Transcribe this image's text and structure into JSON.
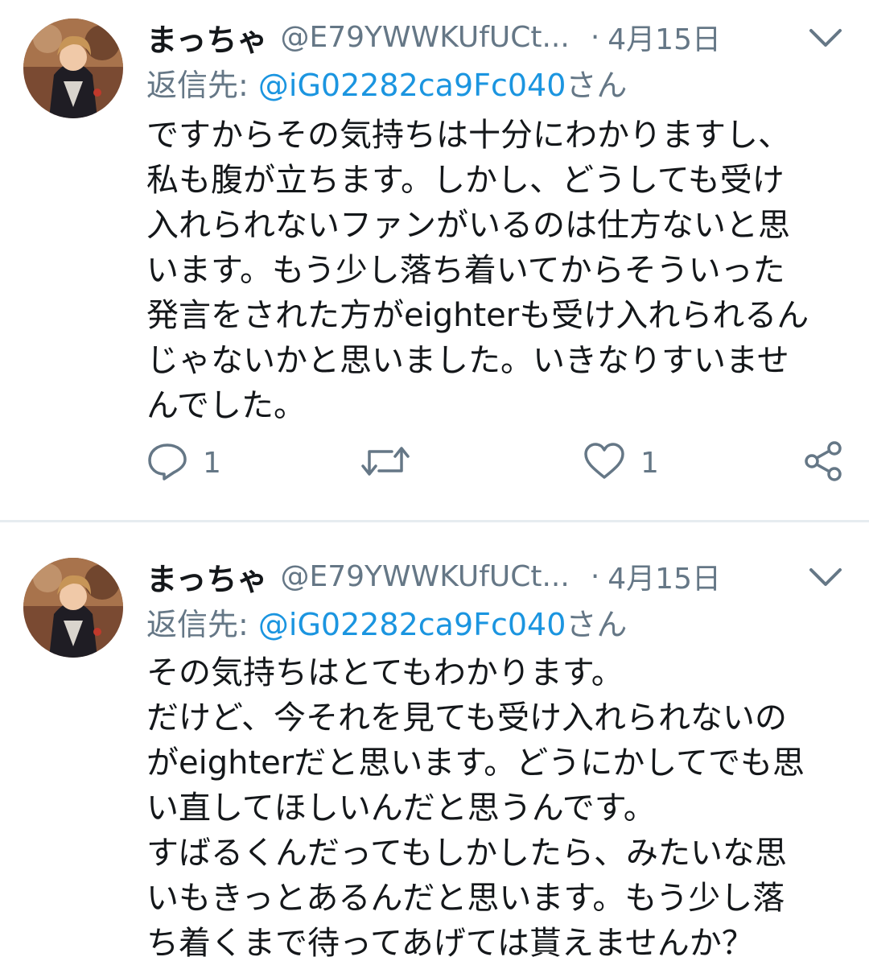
{
  "tweets": [
    {
      "display_name": "まっちゃ",
      "handle": "@E79YWWKUfUCt...",
      "dot": "·",
      "date": "4月15日",
      "reply_prefix": "返信先: ",
      "reply_mention": "@iG02282ca9Fc040",
      "reply_suffix": "さん",
      "text": "ですからその気持ちは十分にわかりますし、\n私も腹が立ちます。しかし、どうしても受け\n入れられないファンがいるのは仕方ないと思\nいます。もう少し落ち着いてからそういった\n発言をされた方がeighterも受け入れられるん\nじゃないかと思いました。いきなりすいませ\nんでした。",
      "reply_count": "1",
      "like_count": "1",
      "icons": {
        "avatar": "avatar-photo",
        "menu": "chevron-down-icon",
        "reply": "reply-bubble-icon",
        "retweet": "retweet-icon",
        "like": "heart-icon",
        "share": "share-icon"
      }
    },
    {
      "display_name": "まっちゃ",
      "handle": "@E79YWWKUfUCt...",
      "dot": "·",
      "date": "4月15日",
      "reply_prefix": "返信先: ",
      "reply_mention": "@iG02282ca9Fc040",
      "reply_suffix": "さん",
      "text": "その気持ちはとてもわかります。\nだけど、今それを見ても受け入れられないの\nがeighterだと思います。どうにかしてでも思\nい直してほしいんだと思うんです。\nすばるくんだってもしかしたら、みたいな思\nいもきっとあるんだと思います。もう少し落\nち着くまで待ってあげては貰えませんか？"
    }
  ],
  "colors": {
    "text": "#14171a",
    "secondary": "#657786",
    "mention": "#1b95e0",
    "divider": "#e6ecf0"
  }
}
